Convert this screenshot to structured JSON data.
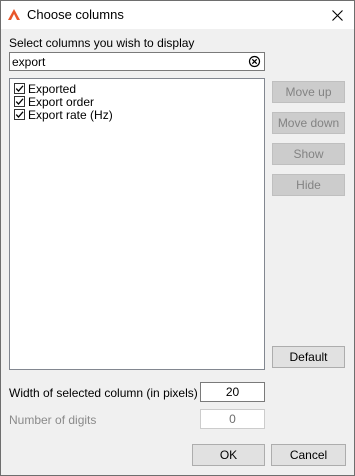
{
  "window": {
    "title": "Choose columns",
    "app_icon": "triangle-logo-icon",
    "close_icon": "close-icon"
  },
  "prompt": "Select columns you wish to display",
  "search": {
    "value": "export",
    "clear_icon": "clear-circle-icon"
  },
  "columns": [
    {
      "label": "Exported",
      "checked": true
    },
    {
      "label": "Export order",
      "checked": true
    },
    {
      "label": "Export rate (Hz)",
      "checked": true
    }
  ],
  "buttons": {
    "move_up": "Move up",
    "move_down": "Move down",
    "show": "Show",
    "hide": "Hide",
    "default": "Default",
    "ok": "OK",
    "cancel": "Cancel"
  },
  "width_field": {
    "label": "Width of selected column (in pixels)",
    "value": "20"
  },
  "digits_field": {
    "label": "Number of digits",
    "value": "0"
  },
  "colors": {
    "accent": "#e8562a",
    "disabled_text": "#838383"
  }
}
